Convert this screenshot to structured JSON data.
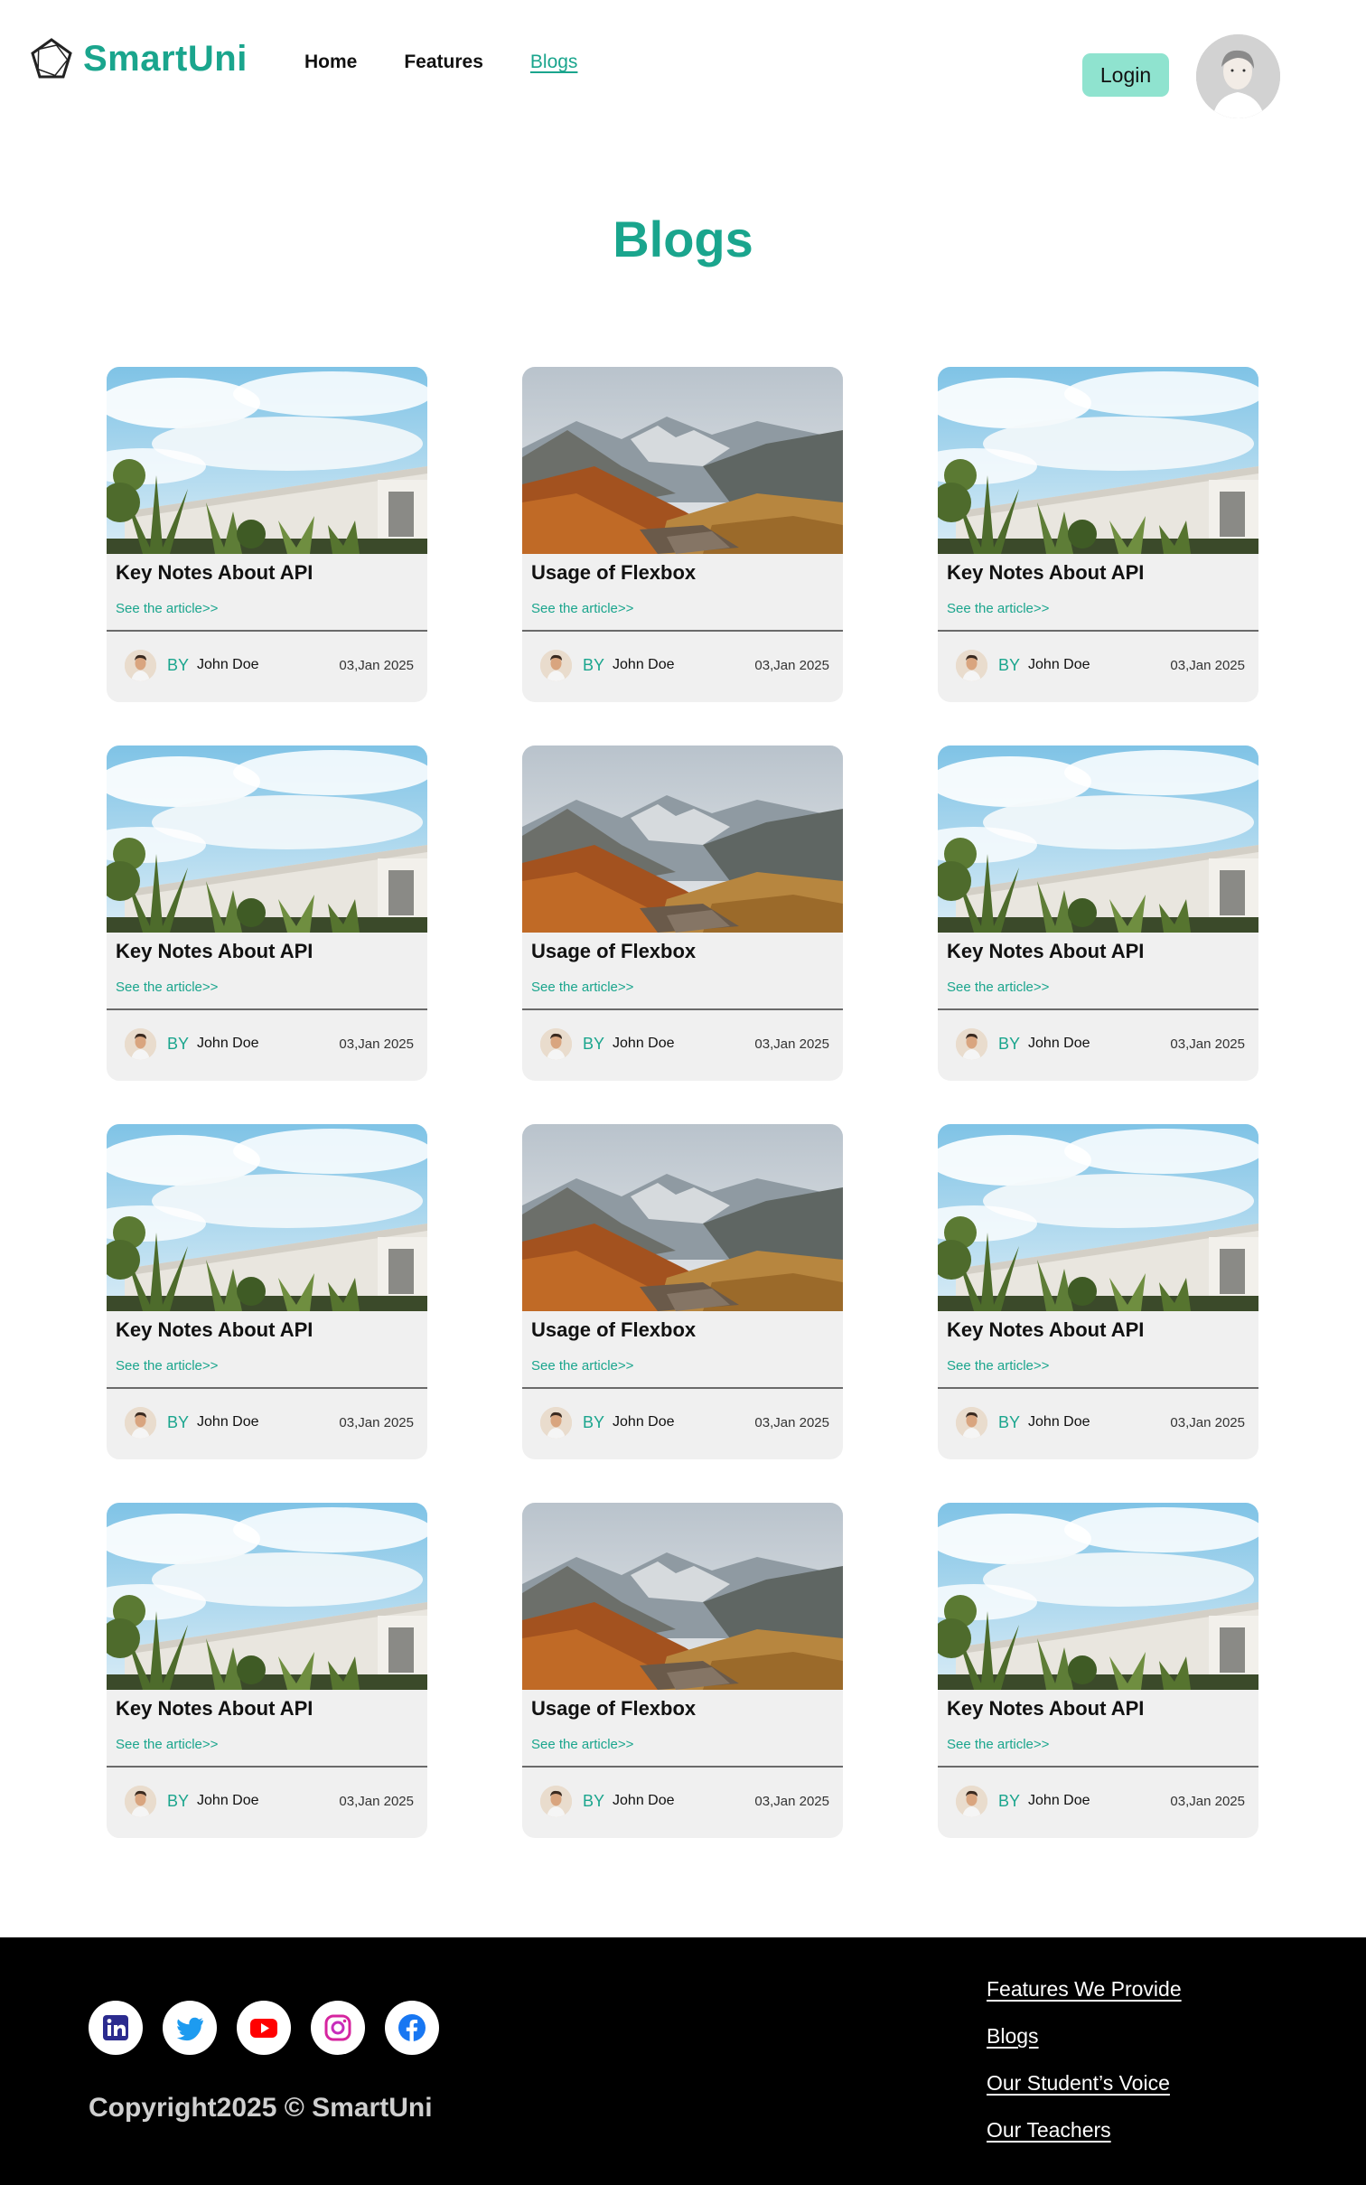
{
  "brand": {
    "name": "SmartUni",
    "color": "#1aa58d"
  },
  "nav": {
    "home": "Home",
    "features": "Features",
    "blogs": "Blogs"
  },
  "header": {
    "login_label": "Login"
  },
  "page": {
    "title": "Blogs"
  },
  "cards": [
    {
      "title": "Key Notes About API",
      "link": "See the article>>",
      "by": "BY",
      "author": "John Doe",
      "date": "03,Jan 2025",
      "image": "building-with-plants"
    },
    {
      "title": "Usage of Flexbox",
      "link": "See the article>>",
      "by": "BY",
      "author": "John Doe",
      "date": "03,Jan 2025",
      "image": "mountain-valley"
    },
    {
      "title": "Key Notes About API",
      "link": "See the article>>",
      "by": "BY",
      "author": "John Doe",
      "date": "03,Jan 2025",
      "image": "building-with-plants"
    },
    {
      "title": "Key Notes About API",
      "link": "See the article>>",
      "by": "BY",
      "author": "John Doe",
      "date": "03,Jan 2025",
      "image": "building-with-plants"
    },
    {
      "title": "Usage of Flexbox",
      "link": "See the article>>",
      "by": "BY",
      "author": "John Doe",
      "date": "03,Jan 2025",
      "image": "mountain-valley"
    },
    {
      "title": "Key Notes About API",
      "link": "See the article>>",
      "by": "BY",
      "author": "John Doe",
      "date": "03,Jan 2025",
      "image": "building-with-plants"
    },
    {
      "title": "Key Notes About API",
      "link": "See the article>>",
      "by": "BY",
      "author": "John Doe",
      "date": "03,Jan 2025",
      "image": "building-with-plants"
    },
    {
      "title": "Usage of Flexbox",
      "link": "See the article>>",
      "by": "BY",
      "author": "John Doe",
      "date": "03,Jan 2025",
      "image": "mountain-valley"
    },
    {
      "title": "Key Notes About API",
      "link": "See the article>>",
      "by": "BY",
      "author": "John Doe",
      "date": "03,Jan 2025",
      "image": "building-with-plants"
    },
    {
      "title": "Key Notes About API",
      "link": "See the article>>",
      "by": "BY",
      "author": "John Doe",
      "date": "03,Jan 2025",
      "image": "building-with-plants"
    },
    {
      "title": "Usage of Flexbox",
      "link": "See the article>>",
      "by": "BY",
      "author": "John Doe",
      "date": "03,Jan 2025",
      "image": "mountain-valley"
    },
    {
      "title": "Key Notes About API",
      "link": "See the article>>",
      "by": "BY",
      "author": "John Doe",
      "date": "03,Jan 2025",
      "image": "building-with-plants"
    }
  ],
  "footer": {
    "socials": [
      "linkedin-icon",
      "twitter-icon",
      "youtube-icon",
      "instagram-icon",
      "facebook-icon"
    ],
    "copyright": "Copyright2025 © SmartUni",
    "links": [
      "Features We Provide",
      "Blogs",
      "Our Student’s Voice",
      "Our Teachers"
    ]
  }
}
